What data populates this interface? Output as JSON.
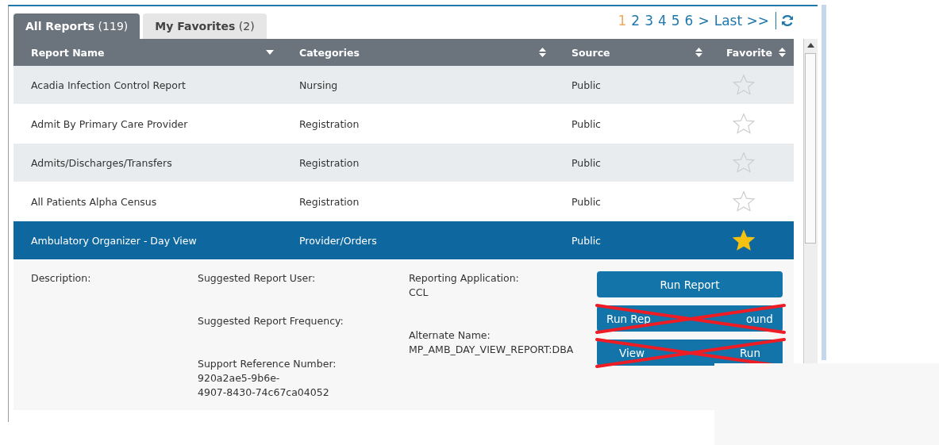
{
  "tabs": [
    {
      "label": "All Reports",
      "count": "(119)",
      "selected": true
    },
    {
      "label": "My Favorites",
      "count": "(2)",
      "selected": false
    }
  ],
  "pager": [
    {
      "label": "1",
      "selected": true
    },
    {
      "label": "2",
      "selected": false
    },
    {
      "label": "3",
      "selected": false
    },
    {
      "label": "4",
      "selected": false
    },
    {
      "label": "5",
      "selected": false
    },
    {
      "label": "6",
      "selected": false
    },
    {
      "label": ">",
      "selected": false
    },
    {
      "label": "Last >>",
      "selected": false
    }
  ],
  "table": {
    "columns": [
      {
        "label": "Report Name",
        "sorted": true
      },
      {
        "label": "Categories",
        "sorted": false
      },
      {
        "label": "Source",
        "sorted": false
      },
      {
        "label": "Favorite",
        "sorted": false
      }
    ],
    "rows": [
      {
        "name": "Acadia Infection Control Report",
        "category": "Nursing",
        "source": "Public",
        "favorite": false,
        "selected": false
      },
      {
        "name": "Admit By Primary Care Provider",
        "category": "Registration",
        "source": "Public",
        "favorite": false,
        "selected": false
      },
      {
        "name": "Admits/Discharges/Transfers",
        "category": "Registration",
        "source": "Public",
        "favorite": false,
        "selected": false
      },
      {
        "name": "All Patients Alpha Census",
        "category": "Registration",
        "source": "Public",
        "favorite": false,
        "selected": false
      },
      {
        "name": "Ambulatory Organizer - Day View",
        "category": "Provider/Orders",
        "source": "Public",
        "favorite": true,
        "selected": true
      }
    ]
  },
  "details": {
    "columns": [
      [
        {
          "label": "Description:"
        }
      ],
      [
        {
          "label": "Suggested Report User:"
        },
        {
          "label": "Suggested Report Frequency:"
        },
        {
          "label": "Support Reference Number:",
          "value": [
            "920a2ae5-9b6e-",
            "4907-8430-74c67ca04052"
          ]
        }
      ],
      [
        {
          "label": "Reporting Application:",
          "value": [
            "CCL"
          ]
        },
        {
          "label": "Alternate Name:",
          "value": [
            "MP_AMB_DAY_VIEW_REPORT:DBA"
          ]
        }
      ]
    ],
    "buttons": [
      {
        "label": [
          "Run Report"
        ],
        "crossed_out": false
      },
      {
        "label": [
          "Run Rep",
          "ound"
        ],
        "crossed_out": true
      },
      {
        "label": [
          "View",
          "Run"
        ],
        "crossed_out": true
      }
    ]
  }
}
